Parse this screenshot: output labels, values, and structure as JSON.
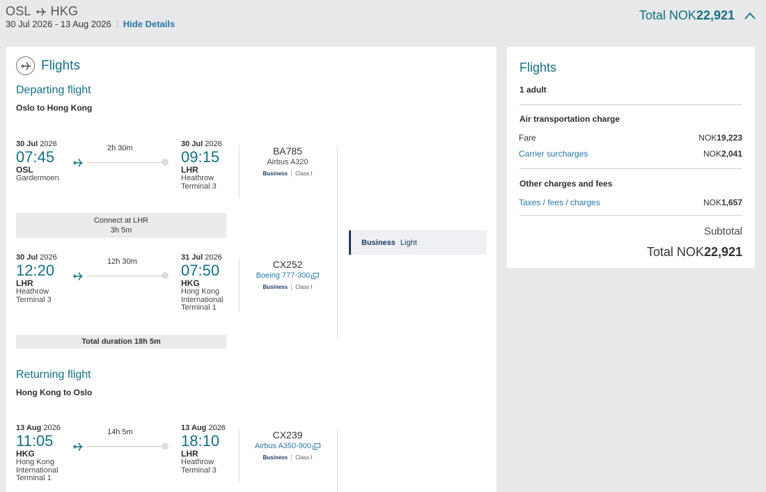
{
  "header": {
    "origin": "OSL",
    "destination": "HKG",
    "dates": "30 Jul 2026 - 13 Aug 2026",
    "hide_details": "Hide Details",
    "total_prefix": "Total NOK",
    "total_amount": "22,921"
  },
  "left": {
    "title": "Flights",
    "departing": {
      "title": "Departing flight",
      "subtitle": "Oslo to Hong Kong",
      "legs": [
        {
          "dep_date_day": "30 Jul",
          "dep_date_year": "2026",
          "dep_time": "07:45",
          "dep_code": "OSL",
          "dep_name": [
            "Gardermoen"
          ],
          "duration": "2h 30m",
          "arr_date_day": "30 Jul",
          "arr_date_year": "2026",
          "arr_time": "09:15",
          "arr_code": "LHR",
          "arr_name": [
            "Heathrow",
            "Terminal 3"
          ],
          "flight_no": "BA785",
          "aircraft": "Airbus A320",
          "aircraft_link": false,
          "cabin": "Business",
          "class": "Class I"
        },
        {
          "dep_date_day": "30 Jul",
          "dep_date_year": "2026",
          "dep_time": "12:20",
          "dep_code": "LHR",
          "dep_name": [
            "Heathrow",
            "Terminal 3"
          ],
          "duration": "12h 30m",
          "arr_date_day": "31 Jul",
          "arr_date_year": "2026",
          "arr_time": "07:50",
          "arr_code": "HKG",
          "arr_name": [
            "Hong Kong",
            "International",
            "Terminal 1"
          ],
          "flight_no": "CX252",
          "aircraft": "Boeing 777-300",
          "aircraft_link": true,
          "cabin": "Business",
          "class": "Class I"
        }
      ],
      "connect_text": "Connect at LHR",
      "connect_duration": "3h 5m",
      "total_duration_label": "Total duration",
      "total_duration": "18h 5m"
    },
    "fare": {
      "cabin": "Business",
      "type": "Light"
    },
    "returning": {
      "title": "Returning flight",
      "subtitle": "Hong Kong to Oslo",
      "legs": [
        {
          "dep_date_day": "13 Aug",
          "dep_date_year": "2026",
          "dep_time": "11:05",
          "dep_code": "HKG",
          "dep_name": [
            "Hong Kong",
            "International",
            "Terminal 1"
          ],
          "duration": "14h 5m",
          "arr_date_day": "13 Aug",
          "arr_date_year": "2026",
          "arr_time": "18:10",
          "arr_code": "LHR",
          "arr_name": [
            "Heathrow",
            "Terminal 3"
          ],
          "flight_no": "CX239",
          "aircraft": "Airbus A350-900",
          "aircraft_link": true,
          "cabin": "Business",
          "class": "Class I"
        }
      ]
    }
  },
  "summary": {
    "title": "Flights",
    "passengers": "1 adult",
    "air_heading": "Air transportation charge",
    "fare_label": "Fare",
    "fare_cur": "NOK",
    "fare_amount": "19,223",
    "surcharge_label": "Carrier surcharges",
    "surcharge_cur": "NOK",
    "surcharge_amount": "2,041",
    "other_heading": "Other charges and fees",
    "taxes_label": "Taxes / fees / charges",
    "taxes_cur": "NOK",
    "taxes_amount": "1,657",
    "subtotal_label": "Subtotal",
    "total_prefix": "Total NOK",
    "total_amount": "22,921"
  },
  "colors": {
    "teal": "#116f85",
    "link": "#2577a8",
    "navy": "#1d3a63",
    "background": "#e8e9ea"
  },
  "icons": [
    "plane-icon",
    "chevron-up-icon",
    "external-window-icon"
  ]
}
